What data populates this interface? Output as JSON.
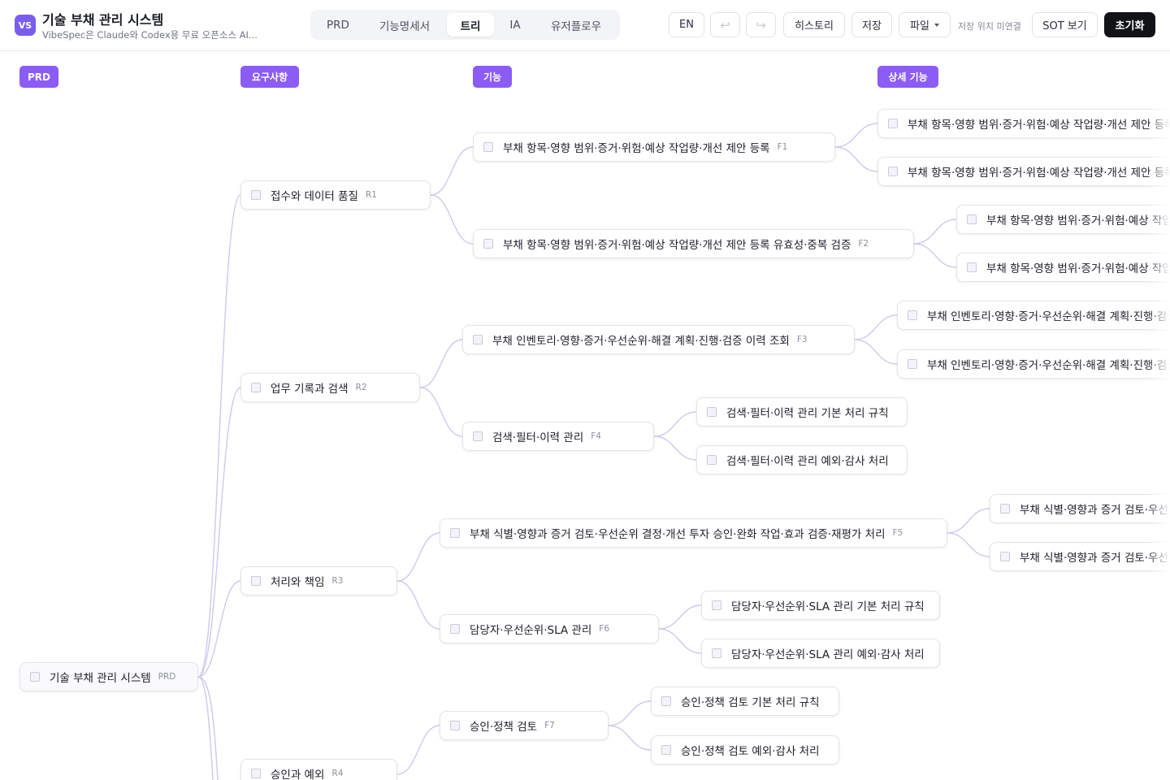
{
  "app": {
    "logo": "VS",
    "title": "기술 부채 관리 시스템",
    "subtitle": "VibeSpec은 Claude와 Codex용 무료 오픈소스 AI..."
  },
  "tabs": [
    {
      "label": "PRD",
      "active": false
    },
    {
      "label": "기능명세서",
      "active": false
    },
    {
      "label": "트리",
      "active": true
    },
    {
      "label": "IA",
      "active": false
    },
    {
      "label": "유저플로우",
      "active": false
    }
  ],
  "toolbar": {
    "lang": "EN",
    "undo_icon": "undo-icon",
    "redo_icon": "redo-icon",
    "history": "히스토리",
    "save": "저장",
    "file": "파일",
    "save_status": "저장 위치 미연결",
    "sot": "SOT 보기",
    "reset": "초기화"
  },
  "columns": [
    "PRD",
    "요구사항",
    "기능",
    "상세 기능"
  ],
  "colors": {
    "accent": "#8b5cf6",
    "edge": "#cfc9ee",
    "dark_button": "#121317"
  },
  "tree": {
    "root": {
      "label": "기술 부채 관리 시스템",
      "code": "PRD"
    },
    "requirements": [
      {
        "label": "접수와 데이터 품질",
        "code": "R1"
      },
      {
        "label": "업무 기록과 검색",
        "code": "R2"
      },
      {
        "label": "처리와 책임",
        "code": "R3"
      },
      {
        "label": "승인과 예외",
        "code": "R4"
      }
    ],
    "features": [
      {
        "label": "부채 항목·영향 범위·증거·위험·예상 작업량·개선 제안 등록",
        "code": "F1"
      },
      {
        "label": "부채 항목·영향 범위·증거·위험·예상 작업량·개선 제안 등록 유효성·중복 검증",
        "code": "F2"
      },
      {
        "label": "부채 인벤토리·영향·증거·우선순위·해결 계획·진행·검증 이력 조회",
        "code": "F3"
      },
      {
        "label": "검색·필터·이력 관리",
        "code": "F4"
      },
      {
        "label": "부채 식별·영향과 증거 검토·우선순위 결정·개선 투자 승인·완화 작업·효과 검증·재평가 처리",
        "code": "F5"
      },
      {
        "label": "담당자·우선순위·SLA 관리",
        "code": "F6"
      },
      {
        "label": "승인·정책 검토",
        "code": "F7"
      }
    ],
    "details": [
      "부채 항목·영향 범위·증거·위험·예상 작업량·개선 제안 등록 기",
      "부채 항목·영향 범위·증거·위험·예상 작업량·개선 제안 등록 예",
      "부채 항목·영향 범위·증거·위험·예상 작업량·개선 제안 등록 유효성",
      "부채 항목·영향 범위·증거·위험·예상 작업량·개선 제안 등록 유효성",
      "부채 인벤토리·영향·증거·우선순위·해결 계획·진행·검증 이력 조회",
      "부채 인벤토리·영향·증거·우선순위·해결 계획·진행·검증 이력 조회",
      "검색·필터·이력 관리 기본 처리 규칙",
      "검색·필터·이력 관리 예외·감사 처리",
      "부채 식별·영향과 증거 검토·우선순위 결정·개선 투자 승인",
      "부채 식별·영향과 증거 검토·우선순위 결정·개선 투자 승인",
      "담당자·우선순위·SLA 관리 기본 처리 규칙",
      "담당자·우선순위·SLA 관리 예외·감사 처리",
      "승인·정책 검토 기본 처리 규칙",
      "승인·정책 검토 예외·감사 처리"
    ]
  }
}
